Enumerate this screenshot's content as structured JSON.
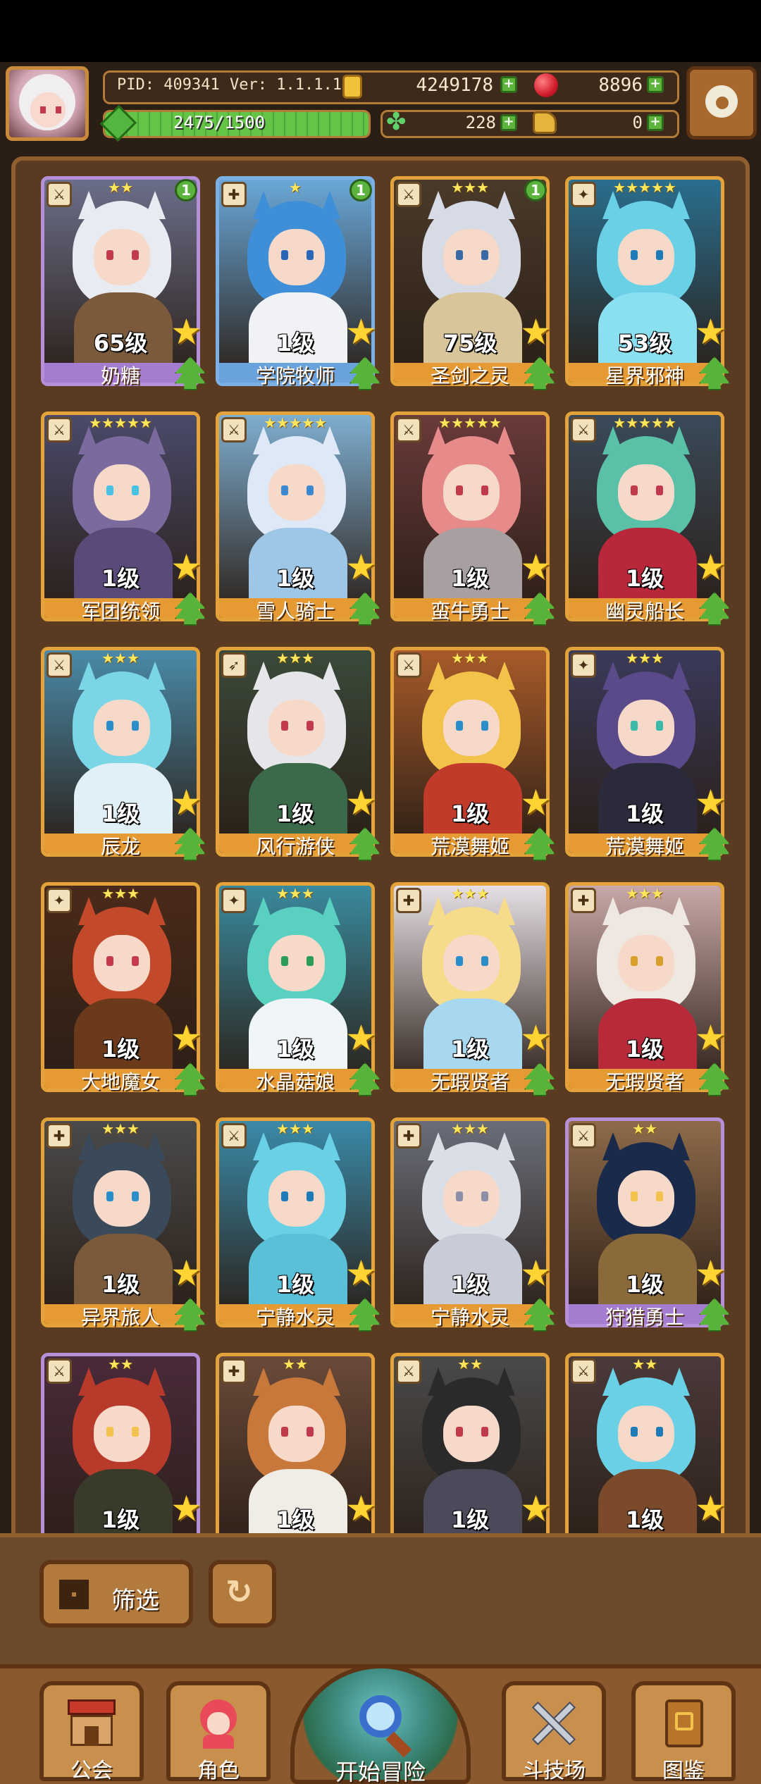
{
  "header": {
    "pid": "PID: 409341",
    "version": "Ver: 1.1.1.10",
    "gold": "4249178",
    "gems": "8896",
    "xp_text": "2475/1500",
    "clover": "228",
    "boots": "0",
    "plus": "+"
  },
  "cards": [
    {
      "stars": "★★",
      "badge": "1",
      "level": "65级",
      "name": "奶糖",
      "rarity": "purple",
      "type": "⚔",
      "colors": {
        "hair": "#e8ecf2",
        "body": "#7a5a3a",
        "eye": "#c23a4c",
        "bg": "#6b6e8a"
      }
    },
    {
      "stars": "★",
      "badge": "1",
      "level": "1级",
      "name": "学院牧师",
      "rarity": "blue",
      "type": "✚",
      "colors": {
        "hair": "#3f8fd8",
        "body": "#f0f2f6",
        "eye": "#2a66b8",
        "bg": "#6aa8d8"
      }
    },
    {
      "stars": "★★★",
      "badge": "1",
      "level": "75级",
      "name": "圣剑之灵",
      "rarity": "gold",
      "type": "⚔",
      "colors": {
        "hair": "#d6dbe6",
        "body": "#d8c59a",
        "eye": "#3a6aa6",
        "bg": "#4a3a2a"
      }
    },
    {
      "stars": "★★★★★",
      "badge": "",
      "level": "53级",
      "name": "星界邪神",
      "rarity": "gold",
      "type": "✦",
      "colors": {
        "hair": "#6ad0e6",
        "body": "#8ae0f0",
        "eye": "#1e7ab8",
        "bg": "#2a6e8e"
      }
    },
    {
      "stars": "★★★★★",
      "badge": "",
      "level": "1级",
      "name": "军团统领",
      "rarity": "gold",
      "type": "⚔",
      "colors": {
        "hair": "#7a6a9e",
        "body": "#5a4a7a",
        "eye": "#4ac2e6",
        "bg": "#4a4a6a"
      }
    },
    {
      "stars": "★★★★★",
      "badge": "",
      "level": "1级",
      "name": "雪人骑士",
      "rarity": "gold",
      "type": "⚔",
      "colors": {
        "hair": "#dfe8f6",
        "body": "#9ec6e6",
        "eye": "#3a88d0",
        "bg": "#7eaed0"
      }
    },
    {
      "stars": "★★★★★",
      "badge": "",
      "level": "1级",
      "name": "蛮牛勇士",
      "rarity": "gold",
      "type": "⚔",
      "colors": {
        "hair": "#e68a8a",
        "body": "#a8a0a0",
        "eye": "#c23a4c",
        "bg": "#6a3a3a"
      }
    },
    {
      "stars": "★★★★★",
      "badge": "",
      "level": "1级",
      "name": "幽灵船长",
      "rarity": "gold",
      "type": "⚔",
      "colors": {
        "hair": "#5ac0a8",
        "body": "#b8283a",
        "eye": "#c23a4c",
        "bg": "#3a4a5a"
      }
    },
    {
      "stars": "★★★",
      "badge": "",
      "level": "1级",
      "name": "辰龙",
      "rarity": "gold",
      "type": "⚔",
      "colors": {
        "hair": "#7ad6e6",
        "body": "#e0f0f6",
        "eye": "#2a8ec8",
        "bg": "#4a8aa8"
      }
    },
    {
      "stars": "★★★",
      "badge": "",
      "level": "1级",
      "name": "风行游侠",
      "rarity": "gold",
      "type": "➶",
      "colors": {
        "hair": "#e6e6ea",
        "body": "#3a6a4a",
        "eye": "#c23a4c",
        "bg": "#3a4a3a"
      }
    },
    {
      "stars": "★★★",
      "badge": "",
      "level": "1级",
      "name": "荒漠舞姬",
      "rarity": "gold",
      "type": "⚔",
      "colors": {
        "hair": "#f2c24a",
        "body": "#c23a2a",
        "eye": "#2a8ec8",
        "bg": "#a85a2a"
      }
    },
    {
      "stars": "★★★",
      "badge": "",
      "level": "1级",
      "name": "荒漠舞姬",
      "rarity": "gold",
      "type": "✦",
      "colors": {
        "hair": "#5a4a8a",
        "body": "#2a2a3a",
        "eye": "#3ab8a8",
        "bg": "#3a3a5a"
      }
    },
    {
      "stars": "★★★",
      "badge": "",
      "level": "1级",
      "name": "大地魔女",
      "rarity": "gold",
      "type": "✦",
      "colors": {
        "hair": "#c24a2a",
        "body": "#6a3a1a",
        "eye": "#c23a4c",
        "bg": "#4a2a1a"
      }
    },
    {
      "stars": "★★★",
      "badge": "",
      "level": "1级",
      "name": "水晶菇娘",
      "rarity": "gold",
      "type": "✦",
      "colors": {
        "hair": "#5ad0c0",
        "body": "#f0f6f8",
        "eye": "#2a9e58",
        "bg": "#3a8a9e"
      }
    },
    {
      "stars": "★★★",
      "badge": "",
      "level": "1级",
      "name": "无瑕贤者",
      "rarity": "gold",
      "type": "✚",
      "colors": {
        "hair": "#f6dc8a",
        "body": "#a8d8f0",
        "eye": "#2a8ec8",
        "bg": "#e6e0e6"
      }
    },
    {
      "stars": "★★★",
      "badge": "",
      "level": "1级",
      "name": "无瑕贤者",
      "rarity": "gold",
      "type": "✚",
      "colors": {
        "hair": "#efe8e0",
        "body": "#b82a3a",
        "eye": "#d8a02a",
        "bg": "#c8a8a8"
      }
    },
    {
      "stars": "★★★",
      "badge": "",
      "level": "1级",
      "name": "异界旅人",
      "rarity": "gold",
      "type": "✚",
      "colors": {
        "hair": "#3a4a5a",
        "body": "#7a5a3a",
        "eye": "#2a8ec8",
        "bg": "#4a4a4a"
      }
    },
    {
      "stars": "★★★",
      "badge": "",
      "level": "1级",
      "name": "宁静水灵",
      "rarity": "gold",
      "type": "⚔",
      "colors": {
        "hair": "#6ad0e6",
        "body": "#5ac0d8",
        "eye": "#1e7ab8",
        "bg": "#3a8aa8"
      }
    },
    {
      "stars": "★★★",
      "badge": "",
      "level": "1级",
      "name": "宁静水灵",
      "rarity": "gold",
      "type": "✚",
      "colors": {
        "hair": "#dadee6",
        "body": "#c8ccd6",
        "eye": "#8a8ea6",
        "bg": "#6a6e7a"
      }
    },
    {
      "stars": "★★",
      "badge": "",
      "level": "1级",
      "name": "狩猎勇士",
      "rarity": "purple",
      "type": "⚔",
      "colors": {
        "hair": "#1a2a4a",
        "body": "#8a6a3a",
        "eye": "#f2c24a",
        "bg": "#8e6a4a"
      }
    },
    {
      "stars": "★★",
      "badge": "",
      "level": "1级",
      "name": "",
      "rarity": "purple",
      "type": "⚔",
      "colors": {
        "hair": "#b83a2a",
        "body": "#3a3a2a",
        "eye": "#f2c24a",
        "bg": "#4a2a3a"
      }
    },
    {
      "stars": "★★",
      "badge": "",
      "level": "1级",
      "name": "",
      "rarity": "gold",
      "type": "✚",
      "colors": {
        "hair": "#c8783a",
        "body": "#f0ece6",
        "eye": "#c23a4c",
        "bg": "#6a4a3a"
      }
    },
    {
      "stars": "★★",
      "badge": "",
      "level": "1级",
      "name": "",
      "rarity": "gold",
      "type": "⚔",
      "colors": {
        "hair": "#2a2a2a",
        "body": "#4a4a5a",
        "eye": "#c23a4c",
        "bg": "#4a4a4a"
      }
    },
    {
      "stars": "★★",
      "badge": "",
      "level": "1级",
      "name": "",
      "rarity": "gold",
      "type": "⚔",
      "colors": {
        "hair": "#6ad0e6",
        "body": "#7a4a2a",
        "eye": "#1e7ab8",
        "bg": "#4a3a3a"
      }
    }
  ],
  "filter": {
    "label": "筛选"
  },
  "nav": {
    "guild": "公会",
    "character": "角色",
    "adventure": "开始冒险",
    "arena": "斗技场",
    "codex": "图鉴"
  },
  "xp_progress": 1.0
}
